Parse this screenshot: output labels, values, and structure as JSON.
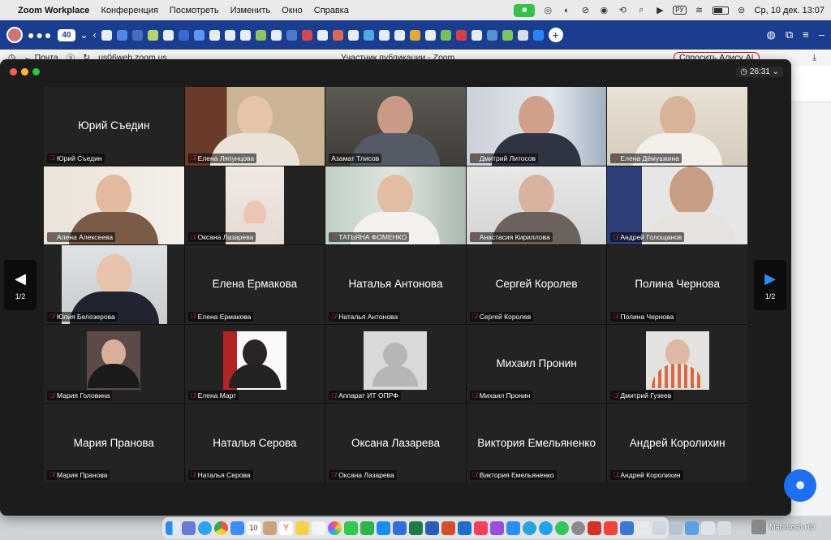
{
  "menubar": {
    "app_name": "Zoom Workplace",
    "items": [
      "Конференция",
      "Посмотреть",
      "Изменить",
      "Окно",
      "Справка"
    ],
    "input_source": "РУ",
    "datetime": "Ср, 10 дек.  13:07"
  },
  "browser": {
    "tab_count": "40",
    "back_label": "Почта",
    "url": "us06web.zoom.us",
    "page_title": "Участник публикации - Zoom",
    "alisa_label": "Спросить Алису AI"
  },
  "zoom": {
    "timer": "26:31",
    "page_indicator_left": "1/2",
    "page_indicator_right": "1/2",
    "tiles": [
      {
        "name": "Юрий Съедин",
        "show_big": true,
        "video": "none"
      },
      {
        "name": "Елена Ляпунцова",
        "show_big": false,
        "video": "cam"
      },
      {
        "name": "Азамат Тлисов",
        "show_big": false,
        "video": "cam",
        "active": true
      },
      {
        "name": "Дмитрий Литосов",
        "show_big": false,
        "video": "cam"
      },
      {
        "name": "Елена Дёмушкина",
        "show_big": false,
        "video": "cam"
      },
      {
        "name": "Алена Алексеева",
        "show_big": false,
        "video": "cam"
      },
      {
        "name": "Оксана Лазарева",
        "show_big": false,
        "video": "cam"
      },
      {
        "name": "ТАТЬЯНА ФОМЕНКО",
        "show_big": false,
        "video": "cam"
      },
      {
        "name": "Анастасия Кириллова",
        "show_big": false,
        "video": "cam"
      },
      {
        "name": "Андрей Голощанов",
        "show_big": false,
        "video": "cam"
      },
      {
        "name": "Юлия Белозерова",
        "show_big": false,
        "video": "cam"
      },
      {
        "name": "Елена Ермакова",
        "show_big": true,
        "video": "none"
      },
      {
        "name": "Наталья Антонова",
        "show_big": true,
        "video": "none"
      },
      {
        "name": "Сергей Королев",
        "show_big": true,
        "video": "none"
      },
      {
        "name": "Полина Чернова",
        "show_big": true,
        "video": "none"
      },
      {
        "name": "Мария Головина",
        "show_big": false,
        "video": "thumb"
      },
      {
        "name": "Елена Март",
        "show_big": false,
        "video": "thumb"
      },
      {
        "name": "Аппарат ИТ ОПРФ",
        "show_big": false,
        "video": "generic"
      },
      {
        "name": "Михаил Пронин",
        "show_big": true,
        "video": "none"
      },
      {
        "name": "Дмитрий Гузеев",
        "show_big": false,
        "video": "thumb"
      },
      {
        "name": "Мария Пранова",
        "show_big": true,
        "video": "none"
      },
      {
        "name": "Наталья Серова",
        "show_big": true,
        "video": "none"
      },
      {
        "name": "Оксана Лазарева",
        "show_big": true,
        "video": "none"
      },
      {
        "name": "Виктория Емельяненко",
        "show_big": true,
        "video": "none"
      },
      {
        "name": "Андрей Королихин",
        "show_big": true,
        "video": "none"
      }
    ]
  },
  "dock": {
    "calendar_day": "10",
    "hd_label": "Macintosh HD"
  }
}
